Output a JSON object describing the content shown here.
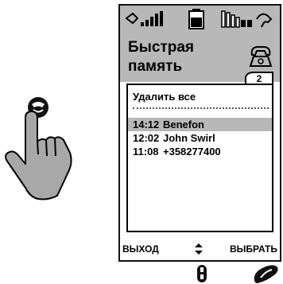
{
  "screen": {
    "title_line1": "Быстрая",
    "title_line2": "память",
    "tab_number": "2"
  },
  "list": {
    "delete_all": "Удалить все",
    "items": [
      {
        "time": "14:12",
        "name": "Benefon"
      },
      {
        "time": "12:02",
        "name": "John Swirl"
      },
      {
        "time": "11:08",
        "name": "+358277400"
      }
    ]
  },
  "softkeys": {
    "left": "ВЫХОД",
    "right": "ВЫБРАТЬ"
  },
  "icons": {
    "signal": "signal-strength-icon",
    "battery": "battery-icon",
    "signal_right": "bars-icon",
    "phone_handset": "phone-handset-icon",
    "scroll": "up-down-arrows-icon",
    "hand": "pointing-hand-icon"
  },
  "colors": {
    "header_bg": "#b8b8b8",
    "selection_bg": "#b8b8b8"
  }
}
